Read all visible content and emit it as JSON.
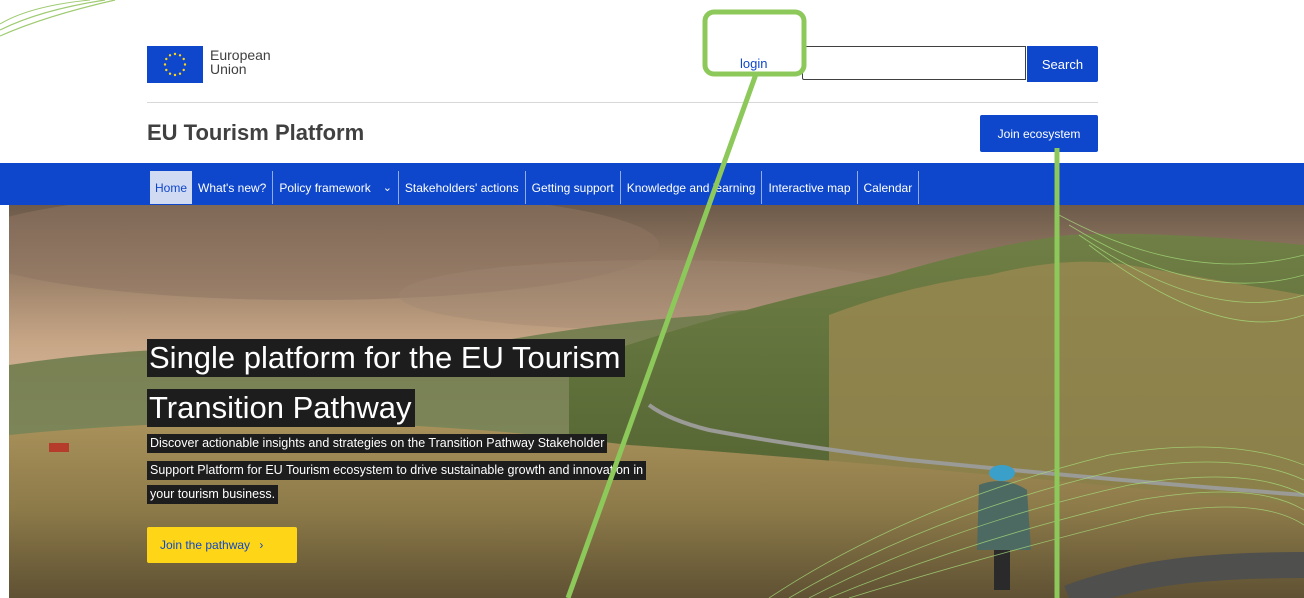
{
  "header": {
    "logo_line1": "European",
    "logo_line2": "Union",
    "login_label": "login",
    "search_value": "",
    "search_button": "Search",
    "site_title": "EU Tourism Platform",
    "join_ecosystem": "Join ecosystem"
  },
  "nav": {
    "items": [
      {
        "label": "Home"
      },
      {
        "label": "What's new?"
      },
      {
        "label": "Policy framework"
      },
      {
        "label": "Stakeholders' actions"
      },
      {
        "label": "Getting support"
      },
      {
        "label": "Knowledge and learning"
      },
      {
        "label": "Interactive map"
      },
      {
        "label": "Calendar"
      }
    ],
    "dropdown_icon": "chevron-down-icon"
  },
  "hero": {
    "headline_line1": "Single platform for the EU Tourism",
    "headline_line2": "Transition Pathway",
    "desc_line1": "Discover actionable insights and strategies on the Transition Pathway Stakeholder",
    "desc_line2": "Support Platform for EU Tourism ecosystem to drive sustainable growth and innovation in",
    "desc_line3": "your tourism business.",
    "cta_label": "Join the pathway",
    "cta_icon": "chevron-right-icon"
  },
  "colors": {
    "primary": "#0e47cb",
    "cta": "#ffd617",
    "annotation": "#8cc85a"
  }
}
